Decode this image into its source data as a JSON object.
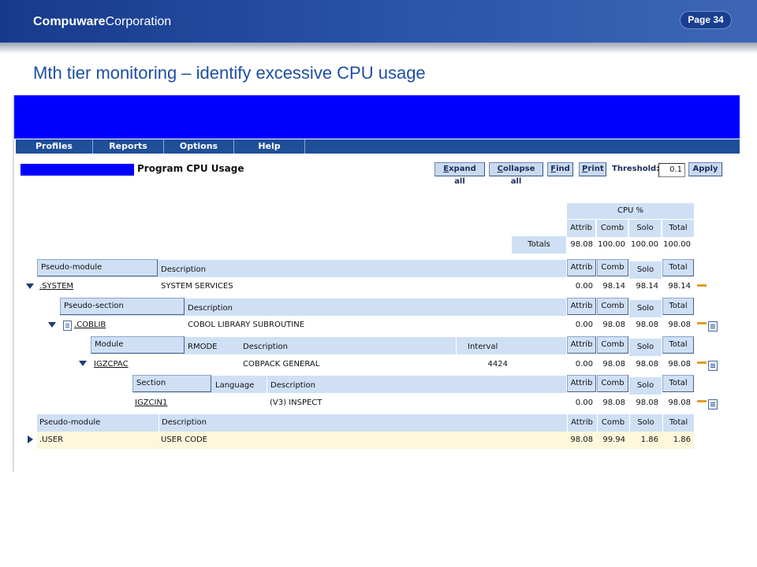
{
  "slide": {
    "brand_bold": "Compuware",
    "brand_rest": "Corporation",
    "page": "Page 34",
    "title": "Mth tier monitoring – identify excessive CPU usage"
  },
  "menu": [
    "Profiles",
    "Reports",
    "Options",
    "Help"
  ],
  "toolbar": {
    "heading": "Program CPU Usage",
    "expand_all": {
      "u": "E",
      "rest": "xpand all"
    },
    "collapse_all": {
      "u": "C",
      "rest": "ollapse all"
    },
    "find": {
      "u": "F",
      "rest": "ind"
    },
    "print": {
      "u": "P",
      "rest": "rint"
    },
    "threshold_label": "Threshold:",
    "threshold_value": "0.1",
    "apply": "Apply"
  },
  "cpu": {
    "group_header": "CPU %",
    "columns": [
      "Attrib",
      "Comb",
      "Solo",
      "Total"
    ],
    "totals_label": "Totals",
    "totals": [
      "98.08",
      "100.00",
      "100.00",
      "100.00"
    ]
  },
  "system": {
    "header_label": "Pseudo-module",
    "desc_label": "Description",
    "name": ".SYSTEM",
    "description": "SYSTEM SERVICES",
    "values": [
      "0.00",
      "98.14",
      "98.14",
      "98.14"
    ]
  },
  "coblib": {
    "header_label": "Pseudo-section",
    "desc_label": "Description",
    "name": ".COBLIB",
    "description": "COBOL LIBRARY SUBROUTINE",
    "values": [
      "0.00",
      "98.08",
      "98.08",
      "98.08"
    ]
  },
  "module": {
    "header_label": "Module",
    "rmode_label": "RMODE",
    "desc_label": "Description",
    "interval_label": "Interval",
    "name": "IGZCPAC",
    "description": "COBPACK GENERAL",
    "interval": "4424",
    "values": [
      "0.00",
      "98.08",
      "98.08",
      "98.08"
    ]
  },
  "section": {
    "header_label": "Section",
    "lang_label": "Language",
    "desc_label": "Description",
    "name": "IGZCIN1",
    "description": "(V3) INSPECT",
    "values": [
      "0.00",
      "98.08",
      "98.08",
      "98.08"
    ]
  },
  "user": {
    "header_label": "Pseudo-module",
    "desc_label": "Description",
    "name": ".USER",
    "description": "USER CODE",
    "values": [
      "98.08",
      "99.94",
      "1.86",
      "1.86"
    ]
  },
  "colors": {
    "header_blue": "#1f4f99",
    "banner_blue": "#0000ff",
    "row_header": "#cfe0f5",
    "user_row": "#fdf8dc",
    "title_blue": "#1f4ea8"
  }
}
